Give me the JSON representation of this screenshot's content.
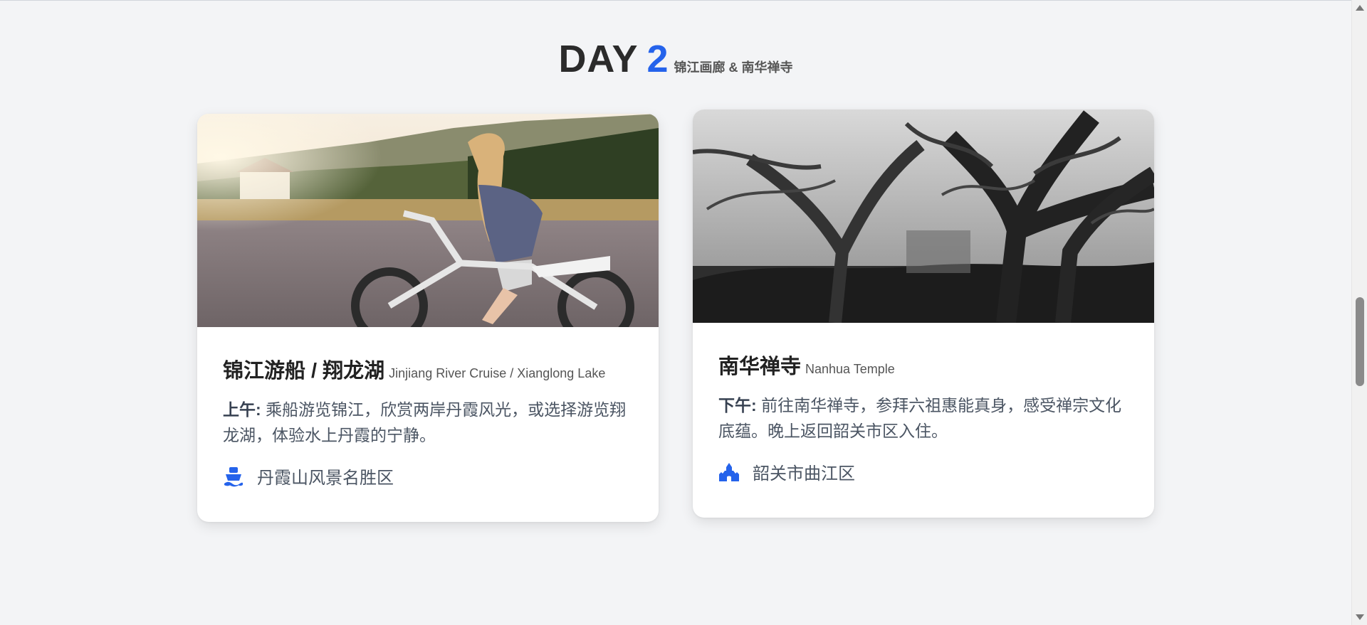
{
  "day_section": {
    "day_word": "DAY",
    "day_number": "2",
    "subtitle": "锦江画廊 & 南华禅寺"
  },
  "cards": [
    {
      "title_cn": "锦江游船 / 翔龙湖",
      "title_en": "Jinjiang River Cruise / Xianglong Lake",
      "time_label": "上午:",
      "description": "乘船游览锦江，欣赏两岸丹霞风光，或选择游览翔龙湖，体验水上丹霞的宁静。",
      "location_icon": "ship-icon",
      "location": "丹霞山风景名胜区"
    },
    {
      "title_cn": "南华禅寺",
      "title_en": "Nanhua Temple",
      "time_label": "下午:",
      "description": "前往南华禅寺，参拜六祖惠能真身，感受禅宗文化底蕴。晚上返回韶关市区入住。",
      "location_icon": "place-of-worship-icon",
      "location": "韶关市曲江区"
    }
  ],
  "colors": {
    "accent": "#2563eb",
    "background": "#f3f4f6",
    "card": "#ffffff"
  }
}
